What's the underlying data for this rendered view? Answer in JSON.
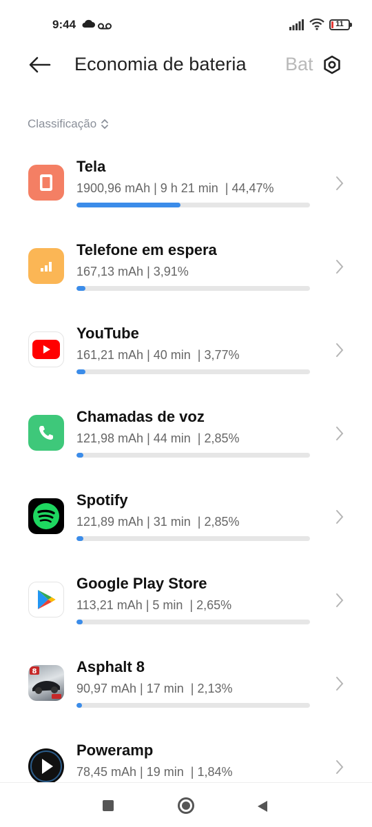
{
  "status_bar": {
    "time": "9:44",
    "battery_level": "11",
    "icons": [
      "cloud-icon",
      "voicemail-icon",
      "signal-icon",
      "wifi-icon",
      "battery-icon"
    ]
  },
  "header": {
    "title": "Economia de bateria",
    "next_tab": "Bat"
  },
  "sort": {
    "label": "Classificação"
  },
  "apps": [
    {
      "name": "Tela",
      "stats": "1900,96 mAh | 9 h 21 min  | 44,47%",
      "percent": 44.47,
      "icon": "screen-icon",
      "color": "#f47f64"
    },
    {
      "name": "Telefone em espera",
      "stats": "167,13 mAh | 3,91%",
      "percent": 3.91,
      "icon": "signal-standby-icon",
      "color": "#fbb655"
    },
    {
      "name": "YouTube",
      "stats": "161,21 mAh | 40 min  | 3,77%",
      "percent": 3.77,
      "icon": "youtube-icon",
      "color": "#ff0000"
    },
    {
      "name": "Chamadas de voz",
      "stats": "121,98 mAh | 44 min  | 2,85%",
      "percent": 2.85,
      "icon": "phone-icon",
      "color": "#3ec87a"
    },
    {
      "name": "Spotify",
      "stats": "121,89 mAh | 31 min  | 2,85%",
      "percent": 2.85,
      "icon": "spotify-icon",
      "color": "#1ed760"
    },
    {
      "name": "Google Play Store",
      "stats": "113,21 mAh | 5 min  | 2,65%",
      "percent": 2.65,
      "icon": "play-store-icon",
      "color": "#01875f"
    },
    {
      "name": "Asphalt 8",
      "stats": "90,97 mAh | 17 min  | 2,13%",
      "percent": 2.13,
      "icon": "asphalt-icon",
      "color": "#c62828"
    },
    {
      "name": "Poweramp",
      "stats": "78,45 mAh | 19 min  | 1,84%",
      "percent": 1.84,
      "icon": "poweramp-icon",
      "color": "#0d0d0d"
    }
  ],
  "accent_color": "#3b8ce9"
}
